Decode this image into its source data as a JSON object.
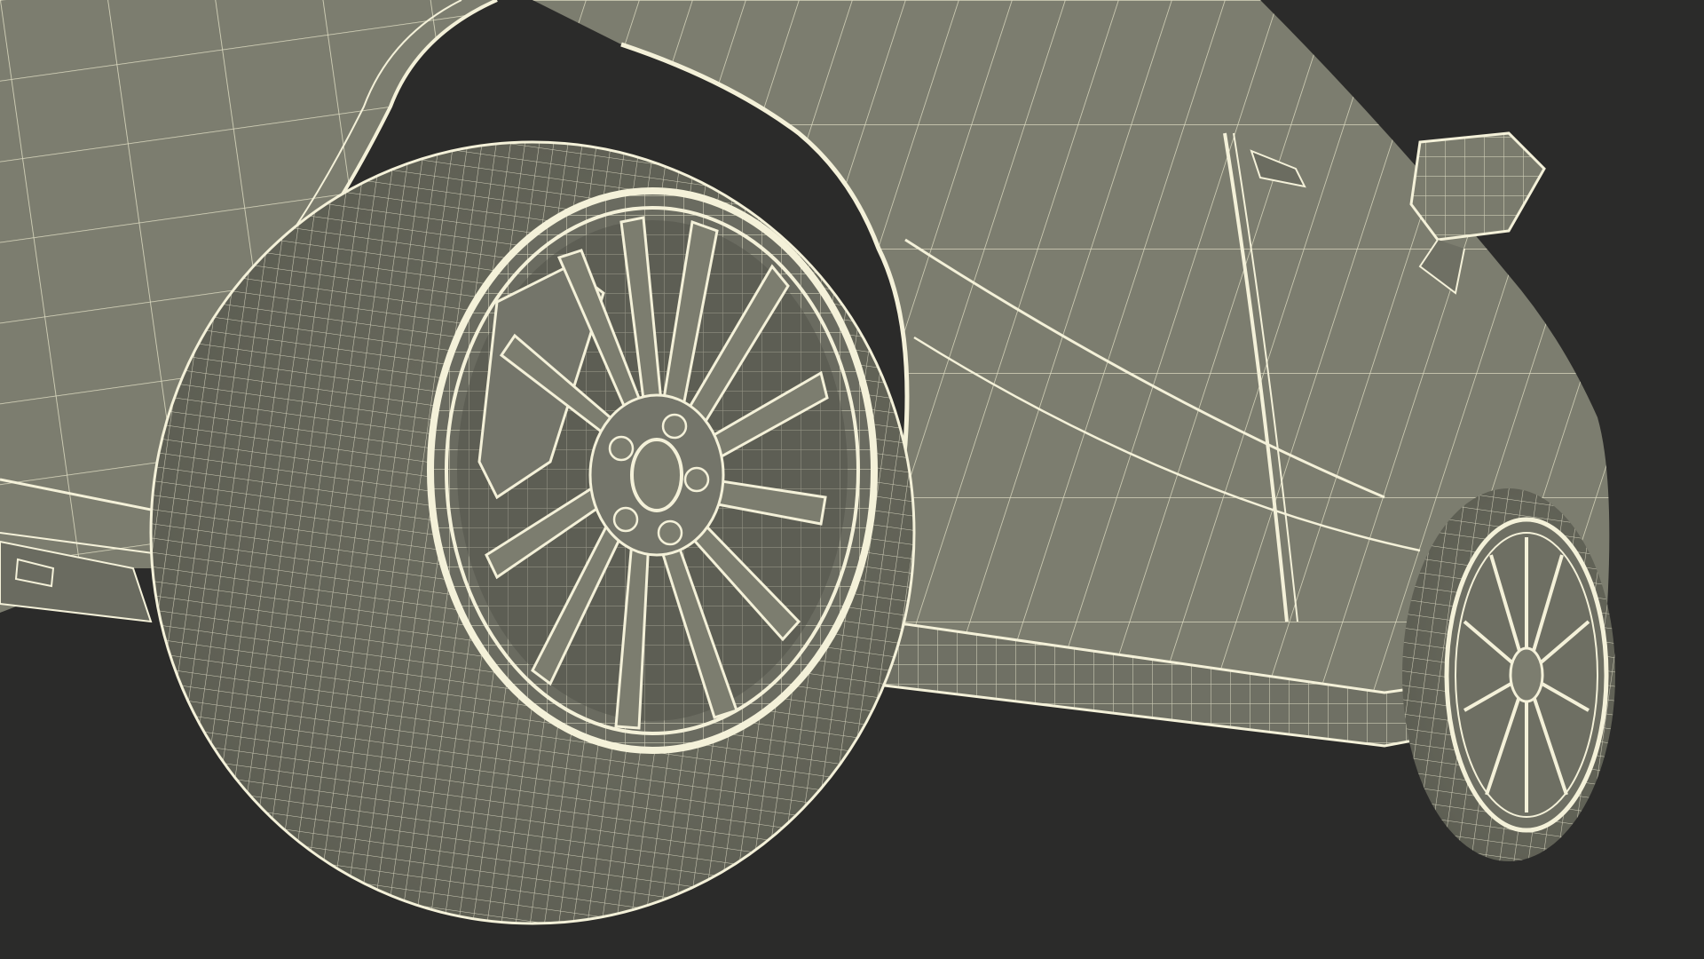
{
  "scene": {
    "background_color": "#2b2b2a",
    "surface_color": "#7c7d6f",
    "surface_shadow_color": "#5f6056",
    "wire_color": "#f4f1d9",
    "rim_highlight_color": "#eeebcf"
  }
}
